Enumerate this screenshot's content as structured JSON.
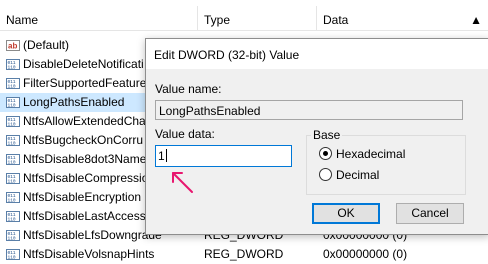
{
  "list": {
    "columns": {
      "name": "Name",
      "type": "Type",
      "data": "Data"
    },
    "rows": [
      {
        "name": "(Default)",
        "type": "",
        "data": "",
        "icon": "string-value-icon",
        "selected": false
      },
      {
        "name": "DisableDeleteNotificati",
        "type": "",
        "data": "",
        "icon": "binary-value-icon",
        "selected": false
      },
      {
        "name": "FilterSupportedFeature",
        "type": "",
        "data": "",
        "icon": "binary-value-icon",
        "selected": false
      },
      {
        "name": "LongPathsEnabled",
        "type": "",
        "data": "",
        "icon": "binary-value-icon",
        "selected": true
      },
      {
        "name": "NtfsAllowExtendedCha",
        "type": "",
        "data": "",
        "icon": "binary-value-icon",
        "selected": false
      },
      {
        "name": "NtfsBugcheckOnCorru",
        "type": "",
        "data": "",
        "icon": "binary-value-icon",
        "selected": false
      },
      {
        "name": "NtfsDisable8dot3Name",
        "type": "",
        "data": "",
        "icon": "binary-value-icon",
        "selected": false
      },
      {
        "name": "NtfsDisableCompressio",
        "type": "",
        "data": "",
        "icon": "binary-value-icon",
        "selected": false
      },
      {
        "name": "NtfsDisableEncryption",
        "type": "",
        "data": "",
        "icon": "binary-value-icon",
        "selected": false
      },
      {
        "name": "NtfsDisableLastAccessU",
        "type": "",
        "data": "",
        "icon": "binary-value-icon",
        "selected": false
      },
      {
        "name": "NtfsDisableLfsDowngrade",
        "type": "REG_DWORD",
        "data": "0x00000000 (0)",
        "icon": "binary-value-icon",
        "selected": false
      },
      {
        "name": "NtfsDisableVolsnapHints",
        "type": "REG_DWORD",
        "data": "0x00000000 (0)",
        "icon": "binary-value-icon",
        "selected": false
      }
    ]
  },
  "dialog": {
    "title": "Edit DWORD (32-bit) Value",
    "value_name_label": "Value name:",
    "value_name": "LongPathsEnabled",
    "value_data_label": "Value data:",
    "value_data": "1",
    "base_label": "Base",
    "base_options": [
      {
        "label": "Hexadecimal",
        "selected": true
      },
      {
        "label": "Decimal",
        "selected": false
      }
    ],
    "ok_label": "OK",
    "cancel_label": "Cancel"
  },
  "colors": {
    "selection": "#cde8ff",
    "accent": "#0078d7",
    "arrow": "#e8176f"
  }
}
